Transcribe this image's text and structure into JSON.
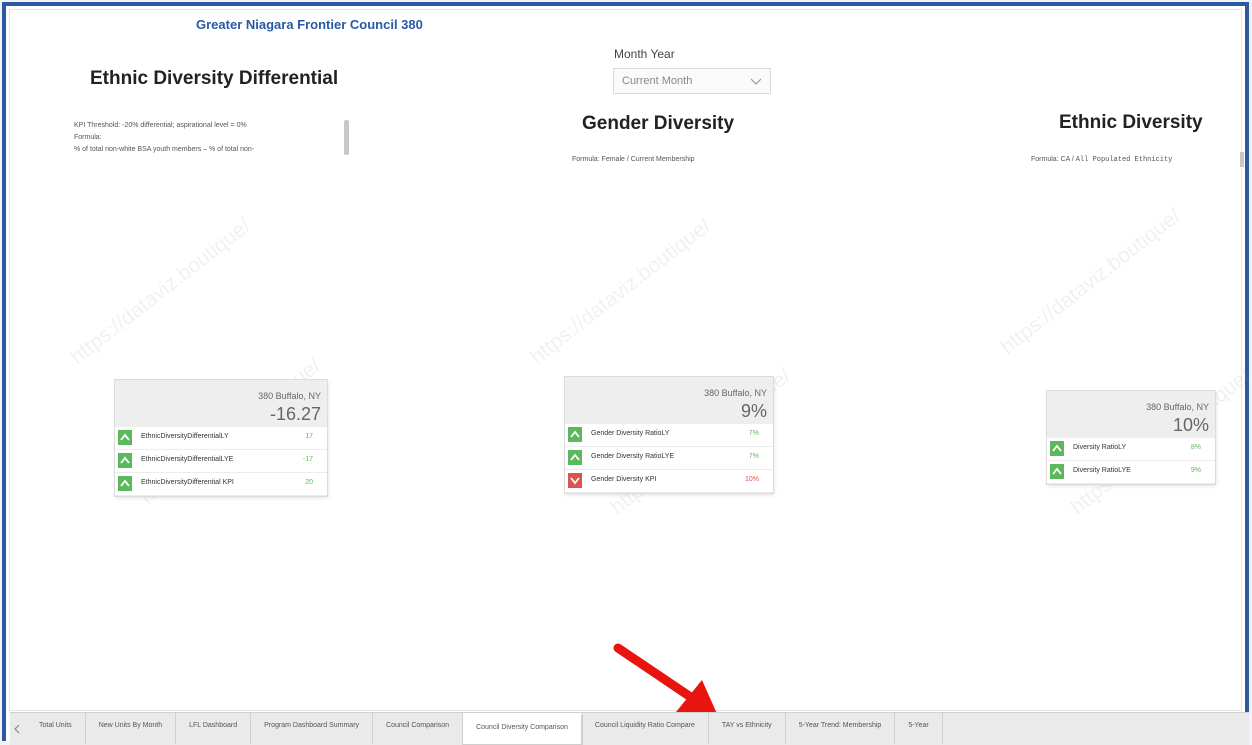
{
  "report": {
    "council_title": "Greater Niagara Frontier Council 380",
    "watermark_text": "https://dataviz.boutique/"
  },
  "filter": {
    "label": "Month Year",
    "selected": "Current Month",
    "icon": "chevron-down-icon"
  },
  "ethnic_diversity_differential": {
    "title": "Ethnic Diversity Differential",
    "description_lines": [
      "KPI Threshold: -20% differential; aspirational level = 0%",
      "Formula:",
      "% of total non-white BSA youth members – % of total non-"
    ],
    "card": {
      "location": "380 Buffalo, NY",
      "value": "-16.27",
      "rows": [
        {
          "name": "EthnicDiversityDifferentialLY",
          "value": "17",
          "status": "up"
        },
        {
          "name": "EthnicDiversityDifferentialLYE",
          "value": "-17",
          "status": "up"
        },
        {
          "name": "EthnicDiversityDifferential KPI",
          "value": "20",
          "status": "up"
        }
      ]
    }
  },
  "gender_diversity": {
    "title": "Gender Diversity",
    "formula": "Formula: Female / Current Membership",
    "card": {
      "location": "380 Buffalo, NY",
      "value": "9%",
      "rows": [
        {
          "name": "Gender Diversity RatioLY",
          "value": "7%",
          "status": "up"
        },
        {
          "name": "Gender Diversity RatioLYE",
          "value": "7%",
          "status": "up"
        },
        {
          "name": "Gender Diversity KPI",
          "value": "10%",
          "status": "down"
        }
      ]
    }
  },
  "ethnic_diversity": {
    "title": "Ethnic Diversity",
    "formula_prefix": "Formula: CA / ",
    "formula_mono": "All Populated Ethnicity",
    "card": {
      "location": "380 Buffalo, NY",
      "value": "10%",
      "rows": [
        {
          "name": "Diversity RatioLY",
          "value": "8%",
          "status": "up"
        },
        {
          "name": "Diversity RatioLYE",
          "value": "9%",
          "status": "up"
        }
      ]
    }
  },
  "colors": {
    "frame_border": "#2f58a3",
    "title_blue": "#2a5aa6",
    "up_green": "#5cb85c",
    "down_red": "#d9534f",
    "annotation_arrow": "#e8140f"
  },
  "tabs": {
    "prev_icon": "chevron-left-icon",
    "items": [
      {
        "label": "Total Units",
        "active": false
      },
      {
        "label": "New Units By Month",
        "active": false
      },
      {
        "label": "LFL Dashboard",
        "active": false
      },
      {
        "label": "Program Dashboard Summary",
        "active": false
      },
      {
        "label": "Council Comparison",
        "active": false
      },
      {
        "label": "Council Diversity Comparison",
        "active": true
      },
      {
        "label": "Council Liquidity Ratio Compare",
        "active": false
      },
      {
        "label": "TAY vs Ethnicity",
        "active": false
      },
      {
        "label": "5-Year Trend: Membership",
        "active": false
      },
      {
        "label": "5-Year",
        "active": false
      }
    ]
  }
}
